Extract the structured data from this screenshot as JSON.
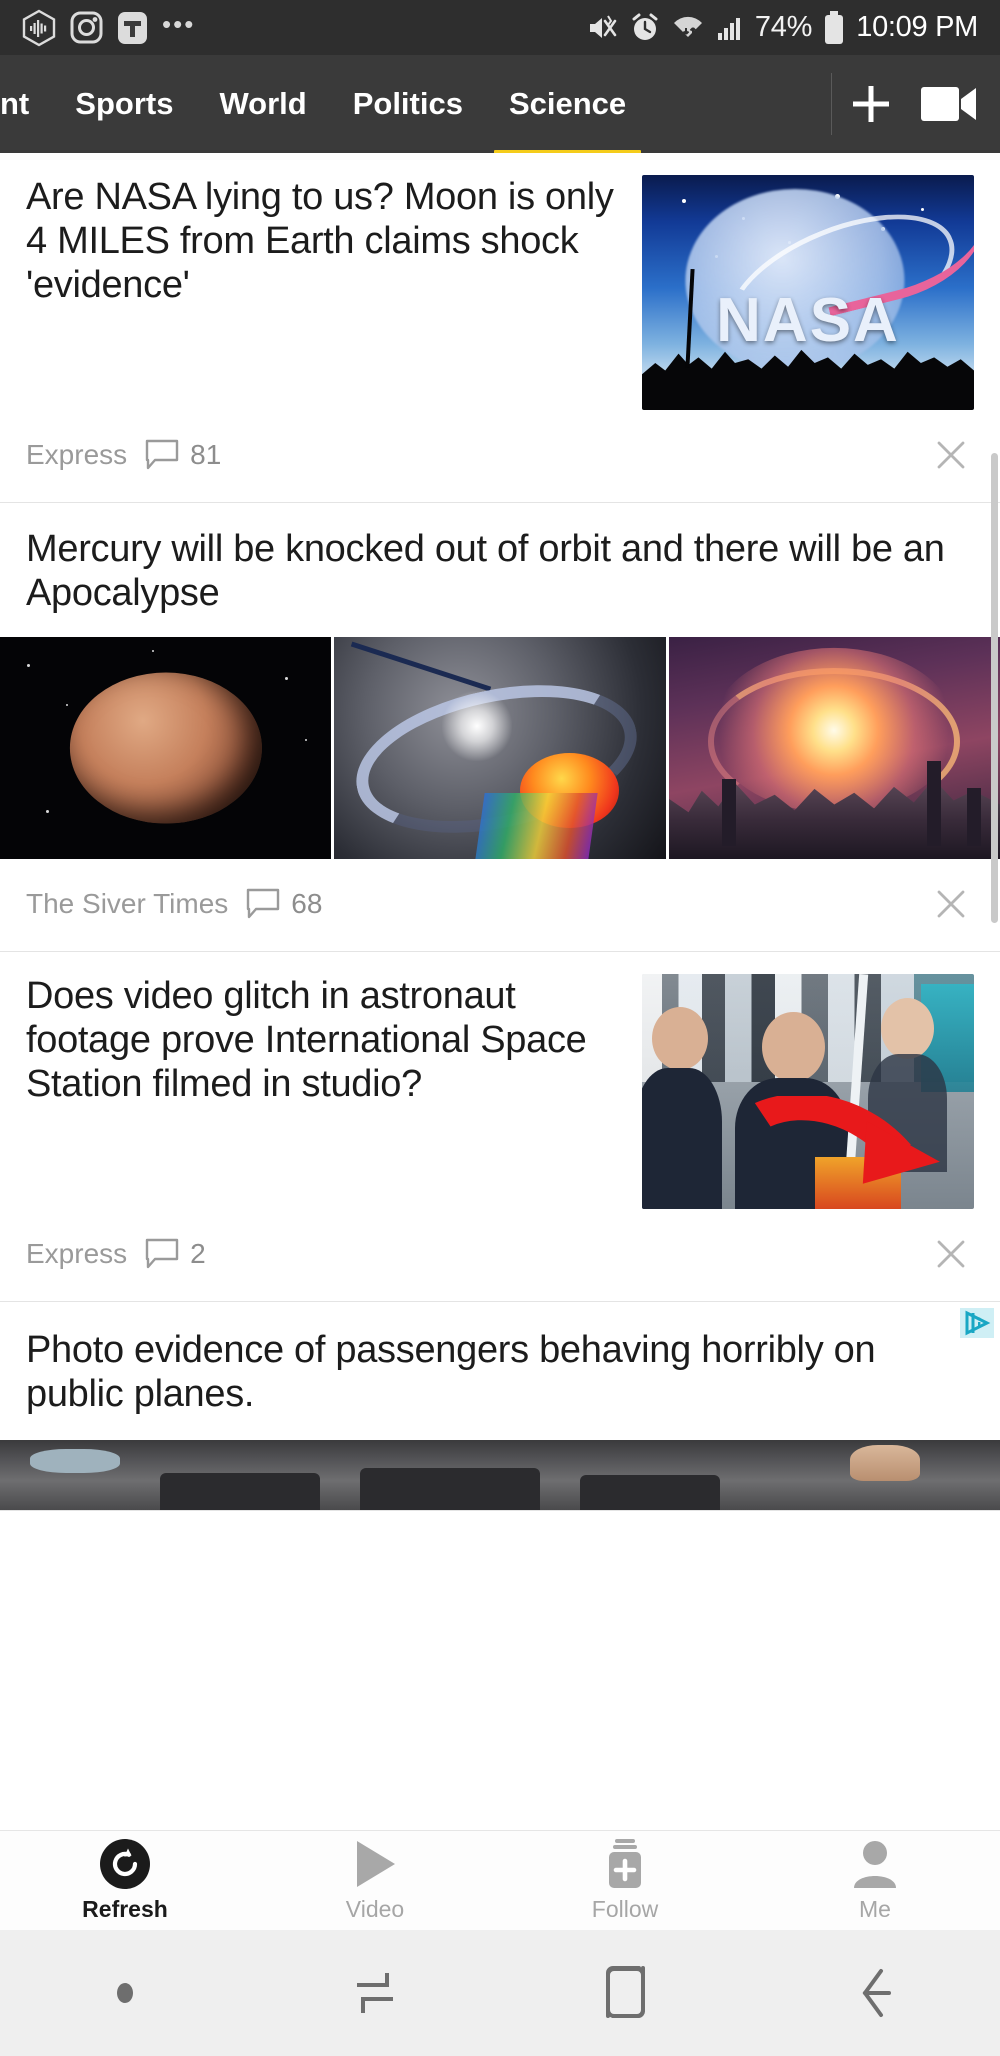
{
  "statusbar": {
    "left_icons": [
      "audio-waveform-app-icon",
      "instagram-icon",
      "t-app-icon"
    ],
    "overflow": "•••",
    "right_icons": [
      "mute-vibrate-icon",
      "alarm-icon",
      "wifi-icon",
      "cellular-signal-icon"
    ],
    "battery_percent": "74%",
    "battery_icon": "battery-icon",
    "time": "10:09 PM"
  },
  "tabbar": {
    "tabs": [
      {
        "label": "nt",
        "active": false
      },
      {
        "label": "Sports",
        "active": false
      },
      {
        "label": "World",
        "active": false
      },
      {
        "label": "Politics",
        "active": false
      },
      {
        "label": "Science",
        "active": true
      }
    ],
    "active_underline_color": "#f5cc1a",
    "actions": [
      {
        "name": "add-button",
        "glyph": "+"
      },
      {
        "name": "video-camera-button",
        "glyph": "video-camera-icon"
      }
    ]
  },
  "feed": {
    "articles": [
      {
        "headline": "Are NASA lying to us? Moon is only 4 MILES from Earth claims shock 'evidence'",
        "source": "Express",
        "comments": "81",
        "layout": "thumb-right",
        "thumb": "nasa-moon-trees-image",
        "close_label": "×"
      },
      {
        "headline": "Mercury will be knocked out of orbit and there will be an Apocalypse",
        "source": "The Siver Times",
        "comments": "68",
        "layout": "three-image-strip",
        "images": [
          "mercury-planet-image",
          "orbital-collision-image",
          "apocalypse-city-image"
        ],
        "close_label": "×"
      },
      {
        "headline": "Does video glitch in astronaut footage prove International Space Station filmed in studio?",
        "source": "Express",
        "comments": "2",
        "layout": "thumb-right",
        "thumb": "astronauts-iss-red-arrow-image",
        "close_label": "×"
      },
      {
        "headline": "Photo evidence of passengers behaving horribly on public planes.",
        "source": "",
        "comments": "",
        "layout": "sponsored-wide",
        "thumb": "airplane-cabin-image",
        "ad_badge": "adchoices-icon"
      }
    ]
  },
  "bottomnav": {
    "items": [
      {
        "label": "Refresh",
        "icon": "refresh-icon",
        "active": true
      },
      {
        "label": "Video",
        "icon": "play-icon",
        "active": false
      },
      {
        "label": "Follow",
        "icon": "follow-plus-icon",
        "active": false
      },
      {
        "label": "Me",
        "icon": "person-icon",
        "active": false
      }
    ]
  },
  "sysnav": {
    "items": [
      {
        "name": "notification-dot-icon"
      },
      {
        "name": "recents-icon"
      },
      {
        "name": "home-icon"
      },
      {
        "name": "back-icon"
      }
    ]
  },
  "colors": {
    "statusbar_bg": "#2e2e2e",
    "tabbar_bg": "#3a3a3a",
    "accent_yellow": "#f5cc1a",
    "text_dark": "#1c1c1c",
    "text_muted": "#9a9a9a",
    "sysnav_bg": "#efefef"
  }
}
